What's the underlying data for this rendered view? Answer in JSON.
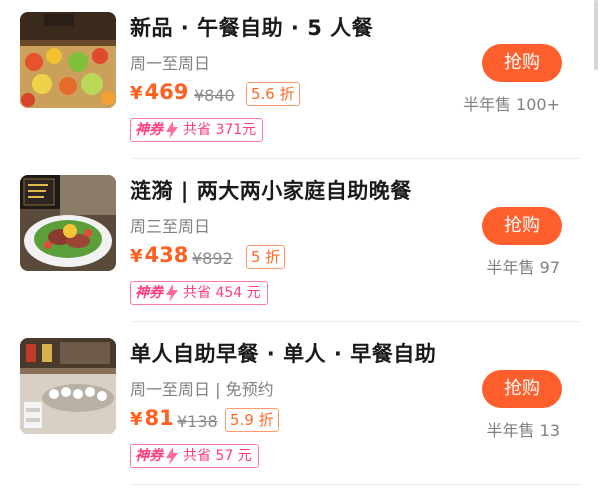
{
  "deals": [
    {
      "title": "新品 · 午餐自助 · 5 人餐",
      "days": "周一至周日",
      "price": "469",
      "currency": "¥",
      "original_price": "¥840",
      "discount": "5.6 折",
      "coupon_brand": "神券",
      "coupon_saving": "共省 371元",
      "buy_label": "抢购",
      "sold": "半年售 100+",
      "thumb_icon": "buffet-food-photo"
    },
    {
      "title": "涟漪 | 两大两小家庭自助晚餐",
      "days": "周三至周日",
      "price": "438",
      "currency": "¥",
      "original_price": "¥892",
      "discount": "5 折",
      "coupon_brand": "神券",
      "coupon_saving": "共省 454 元",
      "buy_label": "抢购",
      "sold": "半年售 97",
      "thumb_icon": "salad-plate-photo"
    },
    {
      "title": "单人自助早餐 · 单人 · 早餐自助",
      "days": "周一至周日 | 免预约",
      "price": "81",
      "currency": "¥",
      "original_price": "¥138",
      "discount": "5.9 折",
      "coupon_brand": "神券",
      "coupon_saving": "共省 57 元",
      "buy_label": "抢购",
      "sold": "半年售 13",
      "thumb_icon": "breakfast-buffet-photo"
    }
  ],
  "colors": {
    "accent": "#ff5f2c",
    "price": "#ff5f1f",
    "coupon": "#ff3d7f",
    "muted": "#808080"
  }
}
